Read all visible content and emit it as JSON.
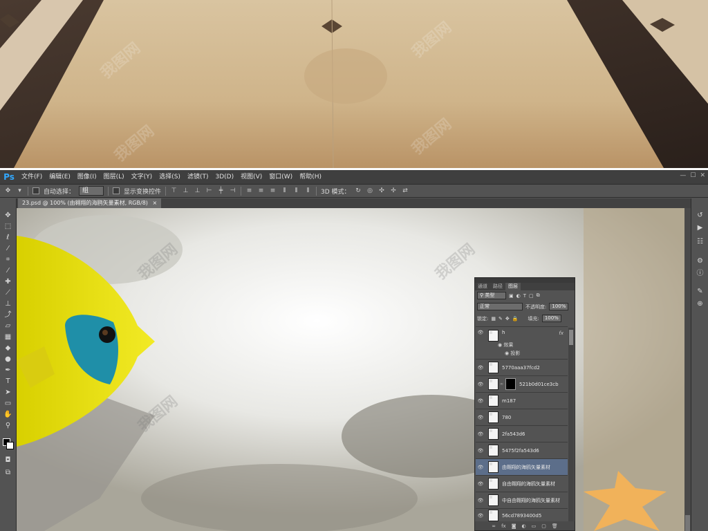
{
  "app": {
    "logo": "Ps",
    "menu": [
      "文件(F)",
      "编辑(E)",
      "图像(I)",
      "图层(L)",
      "文字(Y)",
      "选择(S)",
      "滤镜(T)",
      "3D(D)",
      "视图(V)",
      "窗口(W)",
      "帮助(H)"
    ],
    "window_controls": [
      "—",
      "☐",
      "✕"
    ]
  },
  "options_bar": {
    "auto_select_label": "自动选择：",
    "auto_select_value": "组",
    "show_transform_label": "显示变换控件",
    "mode_3d_label": "3D 模式："
  },
  "document": {
    "tab_title": "23.psd @ 100% (由翱翔的海鸥矢量素材, RGB/8)",
    "tab_close": "×"
  },
  "layers_panel": {
    "tabs": [
      "通道",
      "路径",
      "图层"
    ],
    "active_tab": "图层",
    "filter_kind": "类型",
    "blend_mode": "正常",
    "opacity_label": "不透明度:",
    "opacity_value": "100%",
    "lock_label": "锁定:",
    "fill_label": "填充:",
    "fill_value": "100%",
    "effects_label": "效果",
    "effect_item": "投影",
    "fx_label": "fx",
    "layers": [
      {
        "name": "h",
        "has_fx": true,
        "selected": false
      },
      {
        "name": "5770aaa37fcd2",
        "selected": false
      },
      {
        "name": "521b0d01ce3cb",
        "has_mask": true,
        "selected": false
      },
      {
        "name": "m187",
        "selected": false
      },
      {
        "name": "780",
        "selected": false
      },
      {
        "name": "2fa543d6",
        "selected": false
      },
      {
        "name": "5475f2fa543d6",
        "selected": false
      },
      {
        "name": "由翱翔的海鸥矢量素材",
        "selected": true
      },
      {
        "name": "自由翱翔的海鸥矢量素材",
        "selected": false
      },
      {
        "name": "中自由翱翔的海鸥矢量素材",
        "selected": false
      },
      {
        "name": "56cd7893400d5",
        "selected": false
      }
    ]
  },
  "watermark": "我图网",
  "colors": {
    "ps_blue": "#31a8ff",
    "panel": "#535353",
    "selection": "#5c6e8a"
  }
}
